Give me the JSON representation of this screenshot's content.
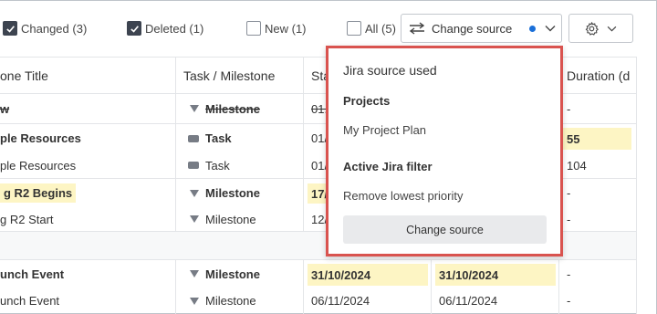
{
  "filters": [
    {
      "label": "Changed (3)",
      "checked": true
    },
    {
      "label": "Deleted (1)",
      "checked": true
    },
    {
      "label": "New (1)",
      "checked": false
    },
    {
      "label": "All (5)",
      "checked": false
    }
  ],
  "source_button": {
    "label": "Change source",
    "icon": "swap-arrows-icon",
    "indicator_color": "#1a6fd8"
  },
  "settings_button": {
    "icon": "gear-icon"
  },
  "table": {
    "headers": [
      "one Title",
      "Task / Milestone",
      "Sta",
      "",
      "Duration (d"
    ],
    "rows": [
      {
        "title": "w",
        "type": "Milestone",
        "start": "01.",
        "end": "",
        "duration": "-",
        "bold": true,
        "deleted": true
      },
      {
        "title": "ple Resources",
        "type": "Task",
        "start": "01/",
        "end": "",
        "duration": "55",
        "bold": true
      },
      {
        "title": "ple Resources",
        "type": "Task",
        "start": "01/",
        "end": "",
        "duration": "104",
        "bold": false
      },
      {
        "title": "g R2 Begins",
        "type": "Milestone",
        "start": "17/",
        "end": "",
        "duration": "-",
        "bold": true
      },
      {
        "title": "g R2 Start",
        "type": "Milestone",
        "start": "12/",
        "end": "",
        "duration": "-",
        "bold": false
      },
      {
        "title": "",
        "type": "",
        "start": "",
        "end": "",
        "duration": "",
        "separator": true
      },
      {
        "title": "unch Event",
        "type": "Milestone",
        "start": "31/10/2024",
        "end": "31/10/2024",
        "duration": "-",
        "bold": true
      },
      {
        "title": "unch Event",
        "type": "Milestone",
        "start": "06/11/2024",
        "end": "06/11/2024",
        "duration": "-",
        "bold": false
      }
    ]
  },
  "popover": {
    "title": "Jira source used",
    "projects_heading": "Projects",
    "project_value": "My Project Plan",
    "filter_heading": "Active Jira filter",
    "filter_value": "Remove lowest priority",
    "button_label": "Change source",
    "border_color": "#d9534f"
  }
}
